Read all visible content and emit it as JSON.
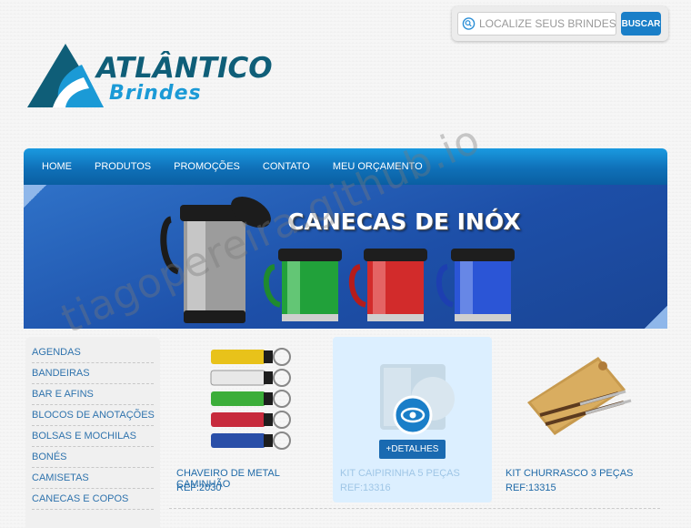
{
  "search": {
    "placeholder": "LOCALIZE SEUS BRINDES!",
    "button_label": "BUSCAR"
  },
  "logo": {
    "line1": "ATLÂNTICO",
    "line2": "Brindes"
  },
  "nav": {
    "items": [
      "HOME",
      "PRODUTOS",
      "PROMOÇÕES",
      "CONTATO",
      "MEU ORÇAMENTO"
    ]
  },
  "banner": {
    "title": "CANECAS DE INÓX"
  },
  "sidebar": {
    "items": [
      "AGENDAS",
      "BANDEIRAS",
      "BAR E AFINS",
      "BLOCOS DE ANOTAÇÕES",
      "BOLSAS E MOCHILAS",
      "BONÉS",
      "CAMISETAS",
      "CANECAS E COPOS"
    ]
  },
  "products": [
    {
      "name": "CHAVEIRO DE METAL CAMINHÃO",
      "ref": "REF:2030"
    },
    {
      "name": "KIT CAIPIRINHA 5 PEÇAS",
      "ref": "REF:13316",
      "details_label": "+DETALHES"
    },
    {
      "name": "KIT CHURRASCO 3 PEÇAS",
      "ref": "REF:13315"
    }
  ],
  "watermark": "tiagopereira.github.io",
  "colors": {
    "nav_blue": "#1a7fc8",
    "banner_blue": "#2258b0",
    "link_blue": "#2f73ad"
  }
}
